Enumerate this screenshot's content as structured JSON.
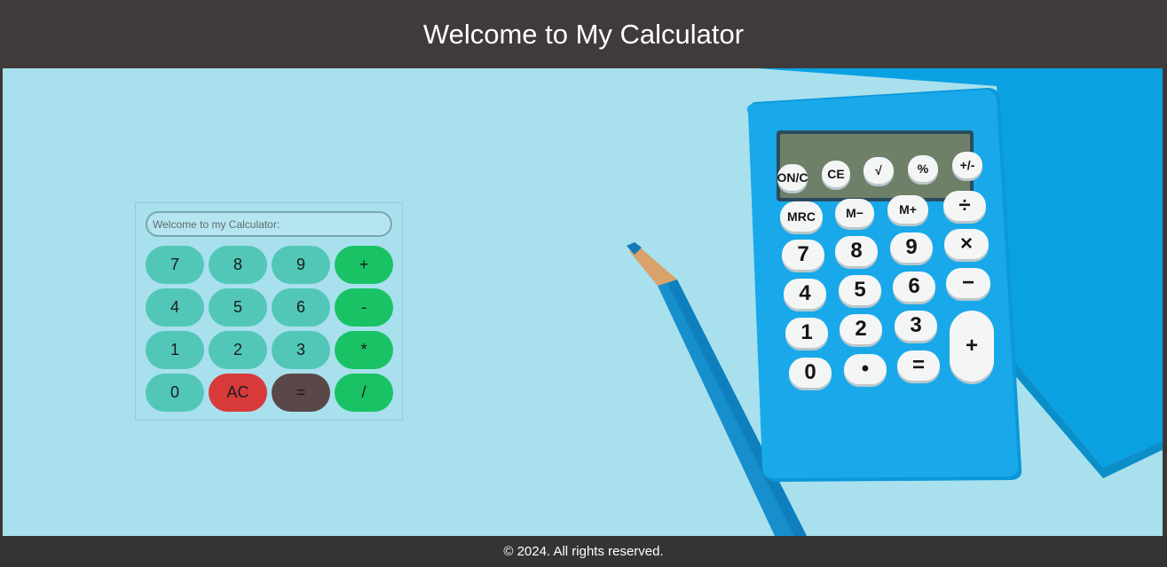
{
  "header": {
    "title": "Welcome to My Calculator"
  },
  "calculator": {
    "display": {
      "value": "",
      "placeholder": "Welcome to my Calculator:"
    },
    "keys": [
      {
        "name": "key-7",
        "label": "7",
        "kind": "num"
      },
      {
        "name": "key-8",
        "label": "8",
        "kind": "num"
      },
      {
        "name": "key-9",
        "label": "9",
        "kind": "num"
      },
      {
        "name": "key-plus",
        "label": "+",
        "kind": "op"
      },
      {
        "name": "key-4",
        "label": "4",
        "kind": "num"
      },
      {
        "name": "key-5",
        "label": "5",
        "kind": "num"
      },
      {
        "name": "key-6",
        "label": "6",
        "kind": "num"
      },
      {
        "name": "key-minus",
        "label": "-",
        "kind": "op"
      },
      {
        "name": "key-1",
        "label": "1",
        "kind": "num"
      },
      {
        "name": "key-2",
        "label": "2",
        "kind": "num"
      },
      {
        "name": "key-3",
        "label": "3",
        "kind": "num"
      },
      {
        "name": "key-multiply",
        "label": "*",
        "kind": "op"
      },
      {
        "name": "key-0",
        "label": "0",
        "kind": "num"
      },
      {
        "name": "key-clear",
        "label": "AC",
        "kind": "clear"
      },
      {
        "name": "key-equals",
        "label": "=",
        "kind": "eq"
      },
      {
        "name": "key-divide",
        "label": "/",
        "kind": "op"
      }
    ]
  },
  "background_image": {
    "calculator_keys": [
      "ON/C",
      "CE",
      "√",
      "%",
      "+/-",
      "MRC",
      "M−",
      "M+",
      "÷",
      "7",
      "8",
      "9",
      "×",
      "4",
      "5",
      "6",
      "−",
      "1",
      "2",
      "3",
      "+",
      "0",
      "•",
      "="
    ]
  },
  "footer": {
    "text": "© 2024. All rights reserved."
  },
  "colors": {
    "header_bg": "#403b3a",
    "hero_bg": "#a9e0ee",
    "number_key": "#52c7b8",
    "operator_key": "#19c365",
    "clear_key": "#d83a3a",
    "equals_key": "#5a4747",
    "footer_bg": "#353434"
  }
}
